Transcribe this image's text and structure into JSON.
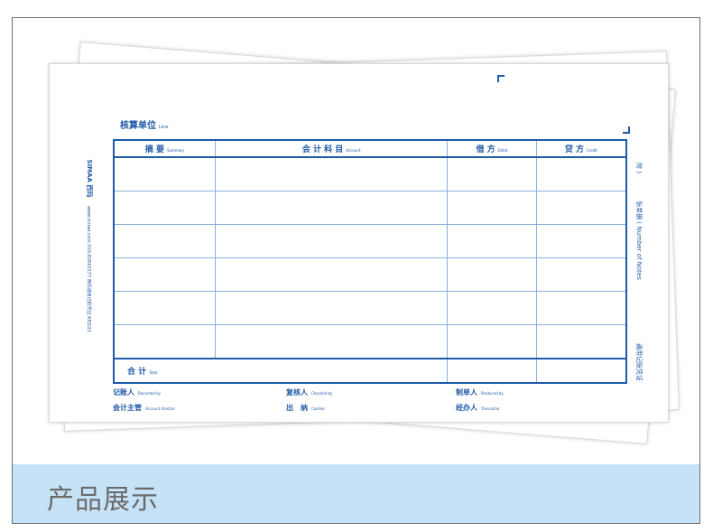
{
  "voucher": {
    "unit_label": "核算单位",
    "unit_label_en": "Line",
    "headers": [
      {
        "zh": "摘 要",
        "en": "Summary"
      },
      {
        "zh": "会 计 科 目",
        "en": "Account"
      },
      {
        "zh": "借 方",
        "en": "Debit"
      },
      {
        "zh": "贷 方",
        "en": "Credit"
      }
    ],
    "total_label": "合 计",
    "total_label_en": "Total",
    "side_brand": "SIMAA 西玛",
    "side_text": "www.simaa.com  010-82843177  西玛通用记账凭证  KPJ103",
    "right_attach": "附 )",
    "right_count": "张单据 ( Number of Notes",
    "right_footer": "通用记账凭证",
    "signatures": {
      "recorder": {
        "zh": "记账人",
        "en": "Recorded by"
      },
      "checker": {
        "zh": "复核人",
        "en": "Checked by"
      },
      "producer": {
        "zh": "制单人",
        "en": "Produced by"
      },
      "director": {
        "zh": "会计主管",
        "en": "Account director"
      },
      "cashier": {
        "zh": "出　纳",
        "en": "Cashier"
      },
      "transactor": {
        "zh": "经办人",
        "en": "Transactor"
      }
    }
  },
  "banner": {
    "title": "产品展示"
  },
  "colors": {
    "ink": "#1e5aa8",
    "grid": "#8bb0dc",
    "banner_bg": "#c6e2f6",
    "banner_text": "#6b6b6b"
  }
}
